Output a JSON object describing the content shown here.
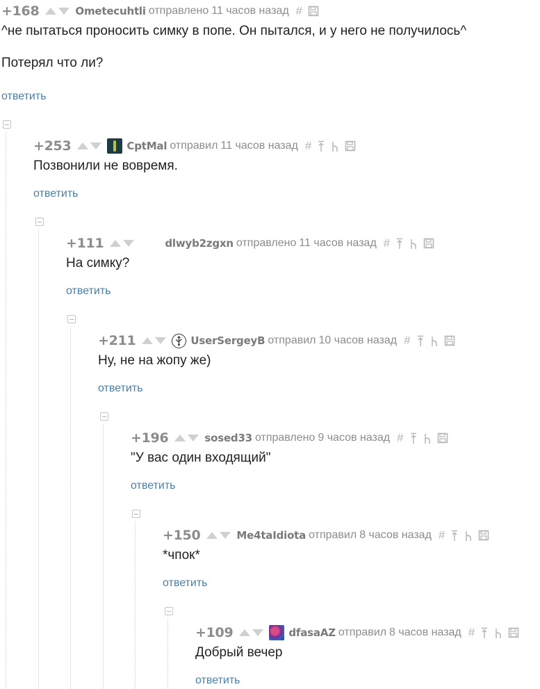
{
  "comments": [
    {
      "rating": "+168",
      "author": "Ometecuhtli",
      "verb": "отправлено",
      "time": "11 часов назад",
      "lines": [
        "^не пытаться проносить симку в попе. Он пытался, и у него не получилось^",
        "Потерял что ли?"
      ],
      "reply": "ответить",
      "avatar": "none"
    },
    {
      "rating": "+253",
      "author": "CptMal",
      "verb": "отправил",
      "time": "11 часов назад",
      "lines": [
        "Позвонили не вовремя."
      ],
      "reply": "ответить",
      "avatar": "user-avatar-image"
    },
    {
      "rating": "+111",
      "author": "dlwyb2zgxn",
      "verb": "отправлено",
      "time": "11 часов назад",
      "lines": [
        "На симку?"
      ],
      "reply": "ответить",
      "avatar": "blank"
    },
    {
      "rating": "+211",
      "author": "UserSergeyB",
      "verb": "отправил",
      "time": "10 часов назад",
      "lines": [
        "Ну, не на жопу же)"
      ],
      "reply": "ответить",
      "avatar": "usb-icon-avatar"
    },
    {
      "rating": "+196",
      "author": "sosed33",
      "verb": "отправлено",
      "time": "9 часов назад",
      "lines": [
        "\"У вас один входящий\""
      ],
      "reply": "ответить",
      "avatar": "none"
    },
    {
      "rating": "+150",
      "author": "Me4taIdiota",
      "verb": "отправил",
      "time": "8 часов назад",
      "lines": [
        "*чпок*"
      ],
      "reply": "ответить",
      "avatar": "none"
    },
    {
      "rating": "+109",
      "author": "dfasaAZ",
      "verb": "отправил",
      "time": "8 часов назад",
      "lines": [
        "Добрый вечер"
      ],
      "reply": "ответить",
      "avatar": "user-avatar-image"
    }
  ],
  "tool_icons": [
    "hash-icon",
    "go-to-parent-icon",
    "go-to-thread-icon",
    "save-icon"
  ],
  "colors": {
    "rating": "#8c8c8c",
    "author": "#7a7a7a",
    "reply_link": "#4a7fa8",
    "tool_icon": "#b5b5b5",
    "vote_arrow": "#d0d0d0"
  }
}
